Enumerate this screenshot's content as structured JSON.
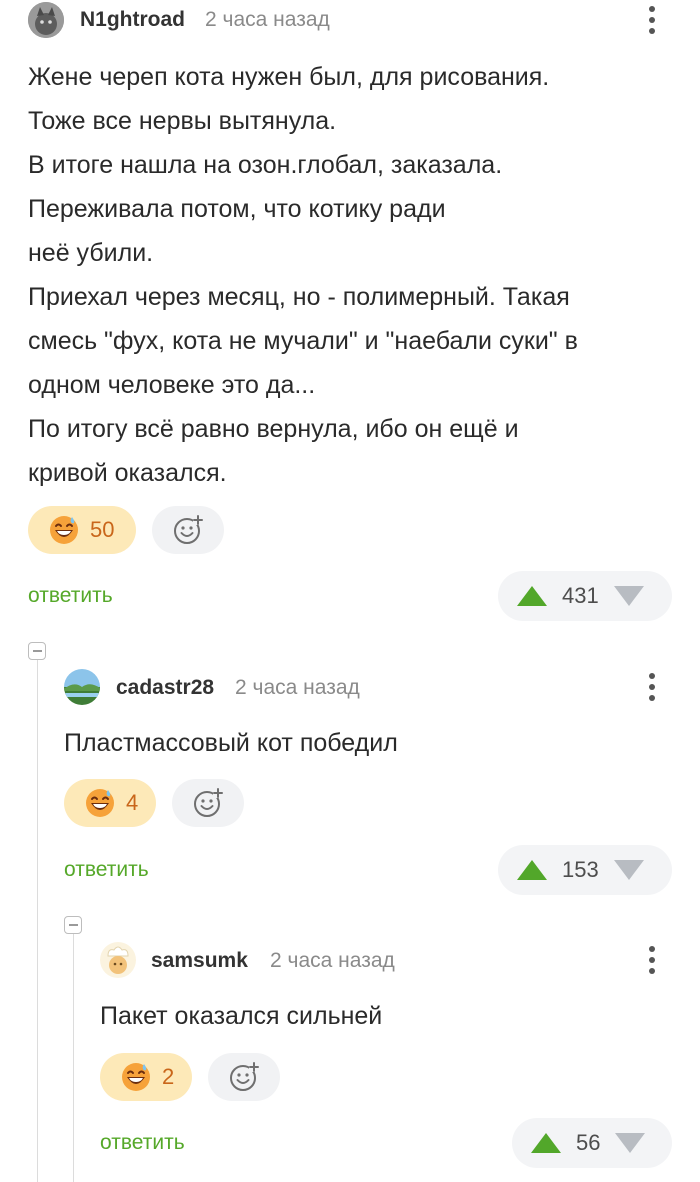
{
  "comments": [
    {
      "username": "N1ghtroad",
      "time": "2 часа назад",
      "lines": [
        "Жене череп кота нужен был, для рисования.",
        "Тоже все нервы вытянула.",
        "В итоге нашла на озон.глобал, заказала.",
        "Переживала потом, что котику ради",
        "неё убили.",
        "Приехал через месяц, но - полимерный. Такая",
        "смесь \"фух, кота не мучали\" и \"наебали суки\" в",
        "одном человеке это да...",
        "По итогу всё равно вернула, ибо он ещё и",
        "кривой оказался."
      ],
      "reaction_count": "50",
      "reply_label": "ответить",
      "rating": "431"
    },
    {
      "username": "cadastr28",
      "time": "2 часа назад",
      "lines": [
        "Пластмассовый кот победил"
      ],
      "reaction_count": "4",
      "reply_label": "ответить",
      "rating": "153"
    },
    {
      "username": "samsumk",
      "time": "2 часа назад",
      "lines": [
        "Пакет оказался сильней"
      ],
      "reaction_count": "2",
      "reply_label": "ответить",
      "rating": "56"
    }
  ],
  "icons": {
    "reaction": "grinning-sweat-emoji-icon",
    "add_reaction": "add-reaction-icon",
    "upvote": "upvote-triangle-icon",
    "downvote": "downvote-triangle-icon",
    "menu": "more-vertical-icon",
    "collapse": "collapse-thread-icon"
  },
  "colors": {
    "reply": "#55a829",
    "upvote": "#52a72a",
    "downvote": "#b8bcc2",
    "reaction_bg": "#fde9b8",
    "reaction_count": "#c9661a"
  }
}
